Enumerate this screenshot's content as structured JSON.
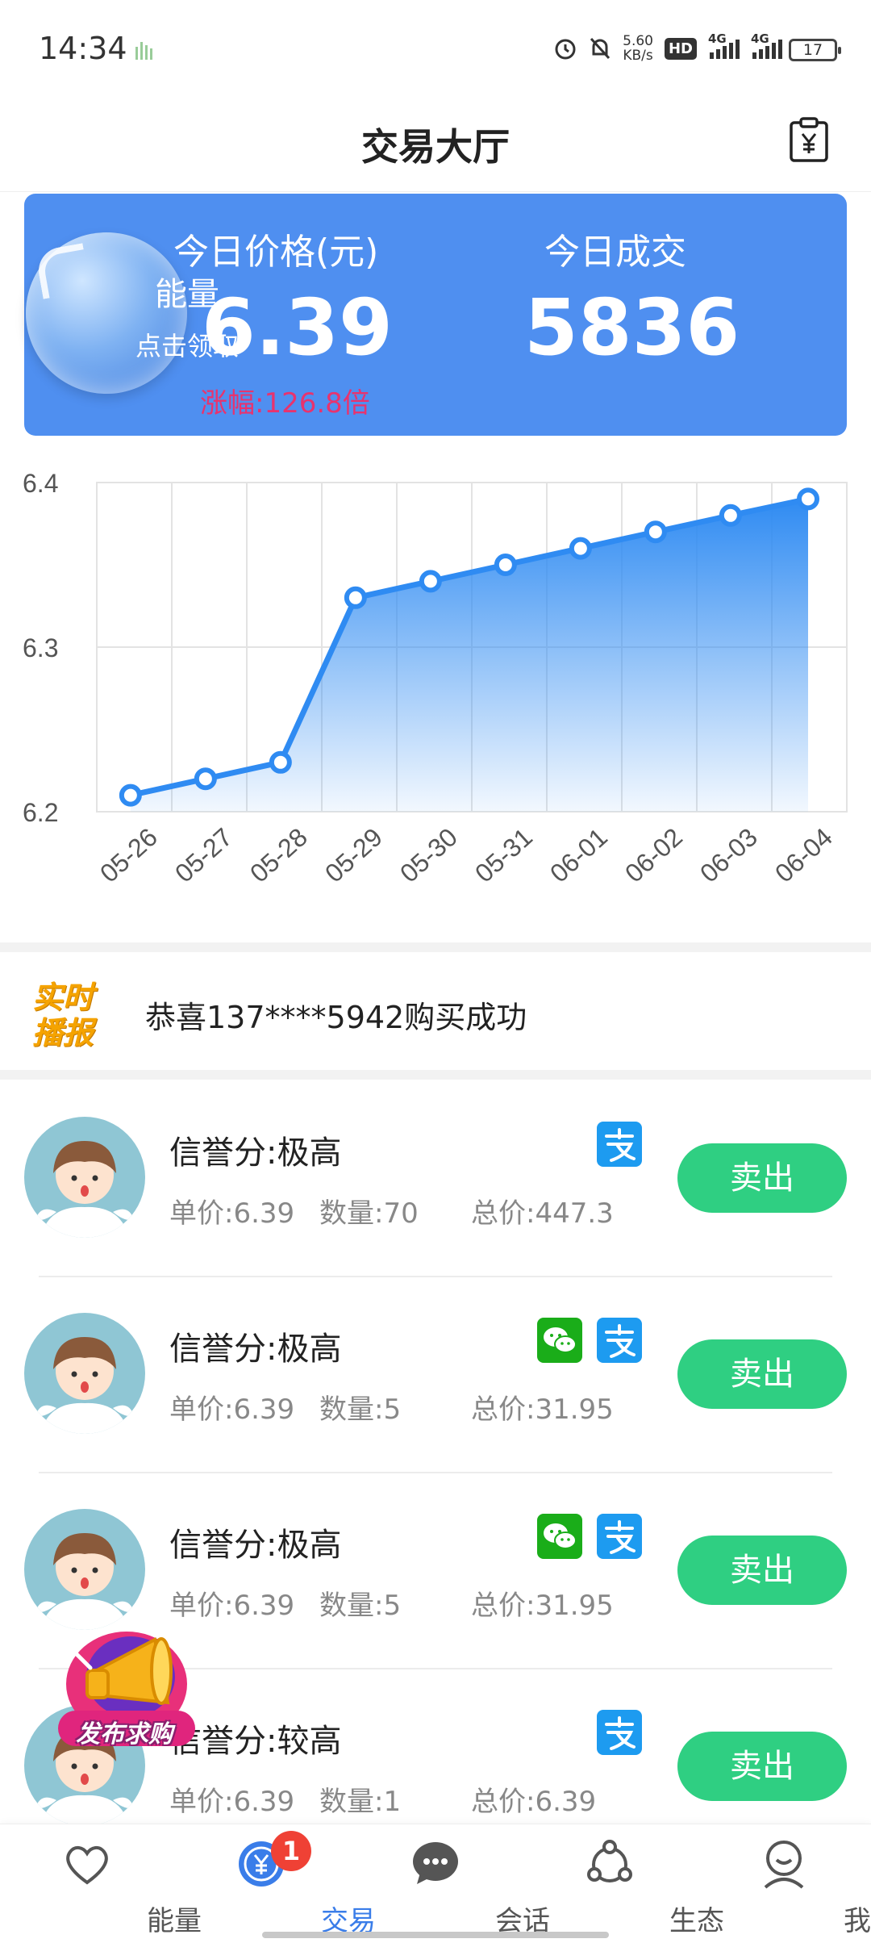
{
  "status_bar": {
    "time": "14:34",
    "net_speed_value": "5.60",
    "net_speed_unit": "KB/s",
    "hd_label": "HD",
    "sim1_label": "4G",
    "sim2_label": "4G",
    "battery": "17"
  },
  "header": {
    "title": "交易大厅"
  },
  "price_card": {
    "energy_title": "能量",
    "energy_sub": "点击领取",
    "price_label": "今日价格(元)",
    "price_value": "6.39",
    "price_change": "涨幅:126.8倍",
    "volume_label": "今日成交",
    "volume_value": "5836",
    "card_color": "#4f8ff0",
    "change_color": "#e8336e"
  },
  "chart_data": {
    "type": "area",
    "title": "",
    "xlabel": "",
    "ylabel": "",
    "x": [
      "05-26",
      "05-27",
      "05-28",
      "05-29",
      "05-30",
      "05-31",
      "06-01",
      "06-02",
      "06-03",
      "06-04"
    ],
    "values": [
      6.21,
      6.22,
      6.23,
      6.33,
      6.34,
      6.35,
      6.36,
      6.37,
      6.38,
      6.39
    ],
    "ylim": [
      6.2,
      6.4
    ],
    "yticks": [
      "6.4",
      "6.3",
      "6.2"
    ],
    "grid": true,
    "line_color": "#2f8bf2"
  },
  "broadcast": {
    "badge_line1": "实时",
    "badge_line2": "播报",
    "message": "恭喜137****5942购买成功"
  },
  "orders": [
    {
      "credit": "信誉分:极高",
      "price": "单价:6.39",
      "qty": "数量:70",
      "total": "总价:447.3",
      "wechat": false,
      "alipay": true,
      "action": "卖出"
    },
    {
      "credit": "信誉分:极高",
      "price": "单价:6.39",
      "qty": "数量:5",
      "total": "总价:31.95",
      "wechat": true,
      "alipay": true,
      "action": "卖出"
    },
    {
      "credit": "信誉分:极高",
      "price": "单价:6.39",
      "qty": "数量:5",
      "total": "总价:31.95",
      "wechat": true,
      "alipay": true,
      "action": "卖出"
    },
    {
      "credit": "信誉分:较高",
      "price": "单价:6.39",
      "qty": "数量:1",
      "total": "总价:6.39",
      "wechat": false,
      "alipay": true,
      "action": "卖出"
    }
  ],
  "float_button": {
    "label": "发布求购"
  },
  "tabs": [
    {
      "label": "能量",
      "icon": "heart-icon",
      "active": false
    },
    {
      "label": "交易",
      "icon": "yen-icon",
      "active": true,
      "badge": "1"
    },
    {
      "label": "会话",
      "icon": "chat-bubble-icon",
      "active": false
    },
    {
      "label": "生态",
      "icon": "network-icon",
      "active": false
    },
    {
      "label": "我的",
      "icon": "user-icon",
      "active": false
    }
  ],
  "colors": {
    "accent": "#3a7de9",
    "sell_button": "#2fcf82",
    "badge": "#ef4135",
    "alipay": "#1d9bf0",
    "wechat": "#1aad19"
  }
}
